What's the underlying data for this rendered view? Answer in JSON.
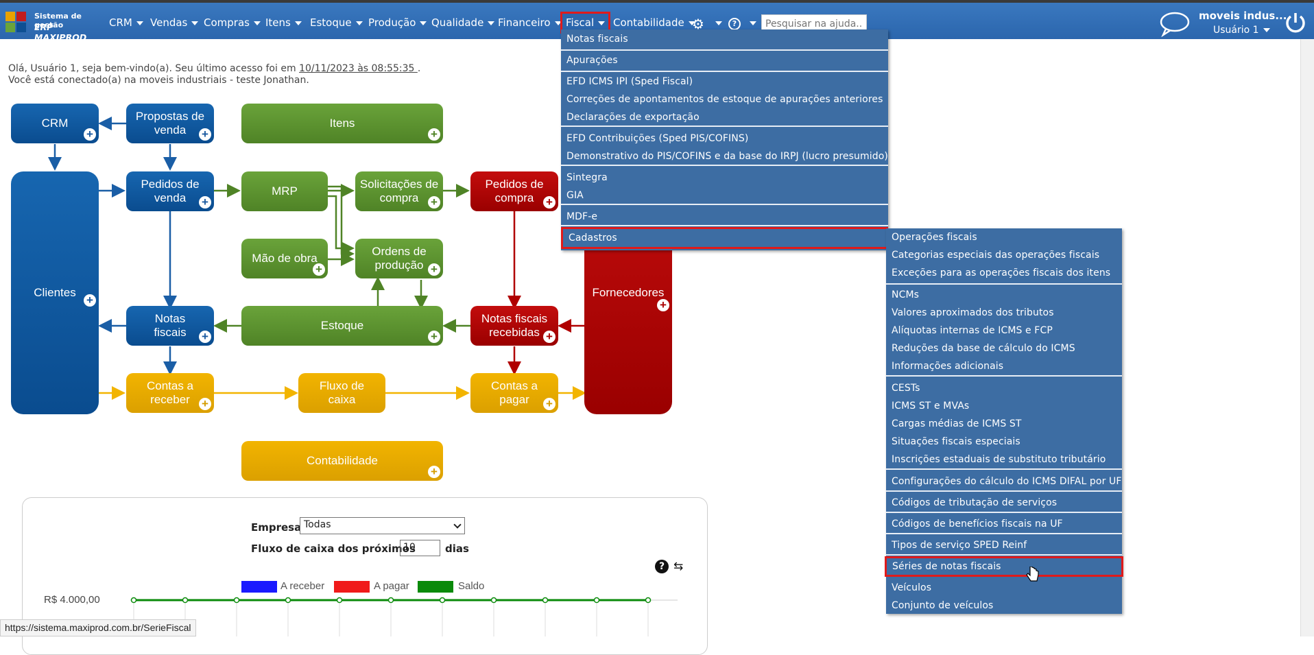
{
  "app": {
    "logo_line1": "Sistema de gestão",
    "logo_line2": "ERP MAXIPROD"
  },
  "nav": [
    "CRM",
    "Vendas",
    "Compras",
    "Itens",
    "Estoque",
    "Produção",
    "Qualidade",
    "Financeiro",
    "Fiscal",
    "Contabilidade"
  ],
  "search": {
    "placeholder": "Pesquisar na ajuda..."
  },
  "account": {
    "company": "moveis indus...",
    "user": "Usuário 1"
  },
  "welcome": {
    "line1a": "Olá, Usuário 1, seja bem-vindo(a). Seu último acesso foi em ",
    "date": "10/11/2023 às 08:55:35 ",
    "line1b": ".",
    "line2": "Você está conectado(a) na moveis industriais - teste Jonathan."
  },
  "diagram": {
    "crm": "CRM",
    "propostas": "Propostas de venda",
    "itens": "Itens",
    "clientes": "Clientes",
    "pedidos_venda": "Pedidos de venda",
    "mrp": "MRP",
    "solicitacoes": "Solicitações de compra",
    "pedidos_compra": "Pedidos de compra",
    "mao_obra": "Mão de obra",
    "ordens": "Ordens de produção",
    "fornecedores": "Fornecedores",
    "notas": "Notas fiscais",
    "estoque": "Estoque",
    "nf_recebidas": "Notas fiscais recebidas",
    "contas_receber": "Contas a receber",
    "fluxo": "Fluxo de caixa",
    "contas_pagar": "Contas a pagar",
    "contabilidade": "Contabilidade"
  },
  "cashflow": {
    "empresa_label": "Empresa",
    "empresa_value": "Todas",
    "fluxo_label": "Fluxo de caixa dos próximos",
    "dias_value": "10",
    "dias_label": "dias",
    "legend": [
      "A receber",
      "A pagar",
      "Saldo"
    ],
    "legend_colors": [
      "#1a1aff",
      "#f01a1a",
      "#0a8a0a"
    ],
    "y_tick": "R$ 4.000,00"
  },
  "chart_data": {
    "type": "line",
    "series": [
      {
        "name": "Saldo",
        "values": [
          4000,
          4000,
          4000,
          4000,
          4000,
          4000,
          4000,
          4000,
          4000,
          4000,
          4000
        ]
      }
    ],
    "yticks": [
      "R$ 4.000,00"
    ]
  },
  "fiscal_menu": [
    {
      "label": "Notas fiscais",
      "sub": true
    },
    {
      "label": "Apurações",
      "sub": true
    },
    {
      "label": "EFD ICMS IPI (Sped Fiscal)"
    },
    {
      "label": "Correções de apontamentos de estoque de apurações anteriores"
    },
    {
      "label": "Declarações de exportação"
    },
    {
      "label": "EFD Contribuições (Sped PIS/COFINS)"
    },
    {
      "label": "Demonstrativo do PIS/COFINS e da base do IRPJ (lucro presumido)"
    },
    {
      "label": "Sintegra"
    },
    {
      "label": "GIA"
    },
    {
      "label": "MDF-e"
    },
    {
      "label": "Cadastros",
      "sub": true
    }
  ],
  "cadastros_menu": [
    "Operações fiscais",
    "Categorias especiais das operações fiscais",
    "Exceções para as operações fiscais dos itens",
    "NCMs",
    "Valores aproximados dos tributos",
    "Alíquotas internas de ICMS e FCP",
    "Reduções da base de cálculo do ICMS",
    "Informações adicionais",
    "CESTs",
    "ICMS ST e MVAs",
    "Cargas médias de ICMS ST",
    "Situações fiscais especiais",
    "Inscrições estaduais de substituto tributário",
    "Configurações do cálculo do ICMS DIFAL por UF",
    "Códigos de tributação de serviços",
    "Códigos de benefícios fiscais na UF",
    "Tipos de serviço SPED Reinf",
    "Séries de notas fiscais",
    "Veículos",
    "Conjunto de veículos"
  ],
  "status_url": "https://sistema.maxiprod.com.br/SerieFiscal"
}
